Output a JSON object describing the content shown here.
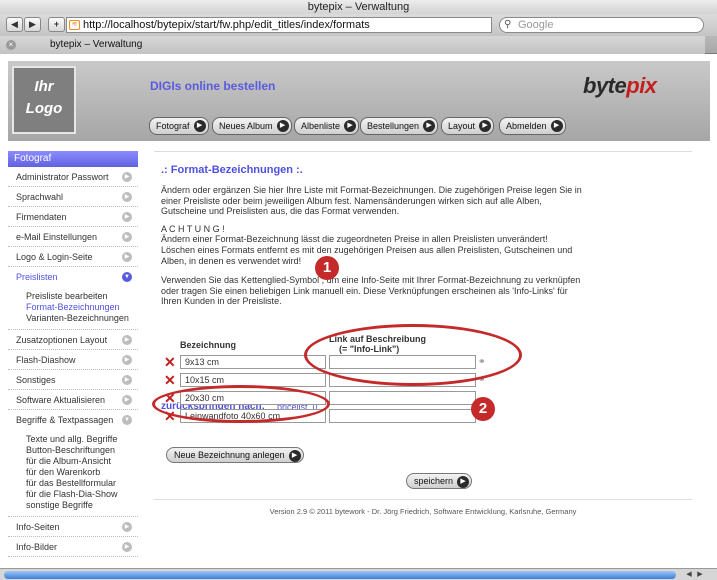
{
  "browser": {
    "window_title": "bytepix – Verwaltung",
    "url": "http://localhost/bytepix/start/fw.php/edit_titles/index/formats",
    "search_placeholder": "Google",
    "tab_title": "bytepix – Verwaltung",
    "back_label": "◀",
    "forward_label": "▶",
    "add_label": "+"
  },
  "header": {
    "logo_line1": "Ihr",
    "logo_line2": "Logo",
    "tagline": "DIGIs online bestellen",
    "brand_main": "byte",
    "brand_accent": "pix",
    "nav": [
      "Fotograf",
      "Neues Album",
      "Albenliste",
      "Bestellungen",
      "Layout",
      "Abmelden"
    ]
  },
  "sidebar": {
    "heading": "Fotograf",
    "items_top": [
      "Administrator Passwort",
      "Sprachwahl",
      "Firmendaten",
      "e-Mail Einstellungen",
      "Logo & Login-Seite"
    ],
    "active_item": "Preislisten",
    "active_subitems": [
      "Preisliste bearbeiten",
      "Format-Bezeichnungen",
      "Varianten-Bezeichnungen"
    ],
    "current_subitem_index": 1,
    "items_mid": [
      "Zusatzoptionen Layout",
      "Flash-Diashow",
      "Sonstiges",
      "Software Aktualisieren",
      "Begriffe & Textpassagen"
    ],
    "begriffe_subitems": [
      "Texte und allg. Begriffe",
      "Button-Beschriftungen",
      "für die Album-Ansicht",
      "für den Warenkorb",
      "für das Bestellformular",
      "für die Flash-Dia-Show",
      "sonstige Begriffe"
    ],
    "items_bottom": [
      "Info-Seiten",
      "Info-Bilder"
    ]
  },
  "main": {
    "title": ".: Format-Bezeichnungen :.",
    "intro": "Ändern oder ergänzen Sie hier Ihre Liste mit Format-Bezeichnungen. Die zugehörigen Preise legen Sie in einer Preisliste oder beim jeweiligen Album fest. Namensänderungen wirken sich auf alle Alben, Gutscheine und Preislisten aus, die das Format verwenden.",
    "warning_head": "A C H T U N G !",
    "warning_line1": "Ändern einer Format-Bezeichnung lässt die zugeordneten Preise in allen Preislisten unverändert!",
    "warning_line2": "Löschen eines Formats entfernt es mit den zugehörigen Preisen aus allen Preislisten, Gutscheinen und Alben, in denen es verwendet wird!",
    "chain_text": "Verwenden Sie das Kettenglied-Symbol  , um eine Info-Seite mit Ihrer Format-Bezeichnung zu verknüpfen oder tragen Sie einen beliebigen Link manuell ein. Diese Verknüpfungen erscheinen als 'Info-Links' für Ihren Kunden in der Preisliste.",
    "jump_label": "zurückspringen nach:",
    "jump_link": "pricelist_0",
    "col_name": "Bezeichnung",
    "col_link_line1": "Link auf Beschreibung",
    "col_link_line2": "(= \"Info-Link\")",
    "formats": [
      "9x13 cm",
      "10x15 cm",
      "20x30 cm",
      "Leinwandfoto 40x60 cm"
    ],
    "new_button": "Neue Bezeichnung anlegen",
    "save_button": "speichern",
    "footer": "Version 2.9 © 2011 bytework - Dr. Jörg Friedrich, Software Entwicklung, Karlsruhe, Germany"
  },
  "annotations": {
    "badge1": "1",
    "badge2": "2"
  },
  "colors": {
    "accent": "#5050e0",
    "annotation_red": "#c42a2a",
    "delete_red": "#c21f1f"
  }
}
